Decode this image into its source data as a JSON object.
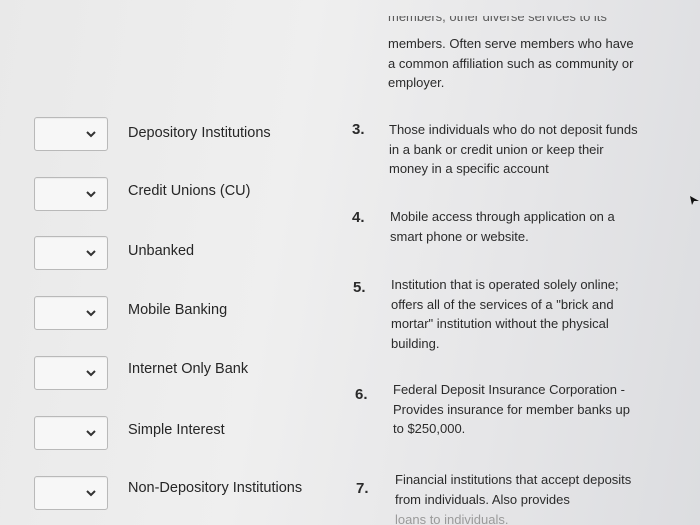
{
  "terms": [
    "Depository Institutions",
    "Credit Unions (CU)",
    "Unbanked",
    "Mobile Banking",
    "Internet Only Bank",
    "Simple Interest",
    "Non-Depository Institutions"
  ],
  "definitions": {
    "d2_top_partial": "members, other diverse services to its",
    "d2": "members. Often serve members who have a common affiliation such as community or employer.",
    "n3": "3.",
    "d3": "Those individuals who do not deposit funds in a bank or credit union or keep their money in a specific account",
    "n4": "4.",
    "d4": "Mobile access through application on a smart phone or website.",
    "n5": "5.",
    "d5": "Institution that is operated solely online; offers all of the services of a \"brick and mortar\" institution without the physical building.",
    "n6": "6.",
    "d6": "Federal Deposit Insurance Corporation - Provides insurance for member banks up to $250,000.",
    "n7": "7.",
    "d7": "Financial institutions that accept deposits from individuals. Also provides",
    "d7_cut": "loans to individuals."
  },
  "icons": {
    "dropdown": "chevron-down-icon",
    "cursor": "cursor-icon"
  }
}
